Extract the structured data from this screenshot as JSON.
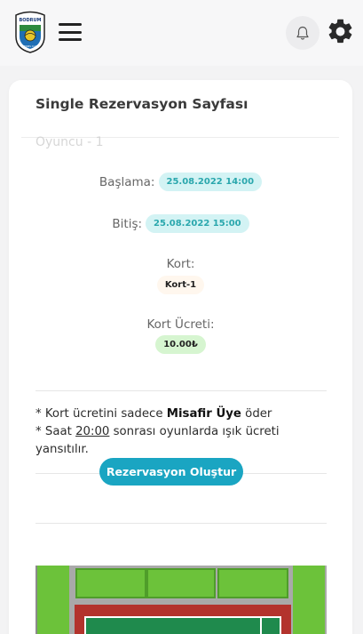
{
  "header": {
    "logo_text_top": "BODRUM",
    "logo_text_bottom": "TENNIS CLUB",
    "menu_icon": "hamburger-menu-icon",
    "notification_icon": "bell-icon",
    "settings_icon": "gear-icon"
  },
  "card": {
    "title": "Single Rezervasyon Sayfası"
  },
  "reservation": {
    "start_label": "Başlama:",
    "start_value": "25.08.2022 14:00",
    "end_label": "Bitiş:",
    "end_value": "25.08.2022 15:00",
    "court_label": "Kort:",
    "court_value": "Kort-1",
    "fee_label": "Kort Ücreti:",
    "fee_value": "10.00₺"
  },
  "notes": {
    "line1_prefix": "* Kort ücretini sadece ",
    "line1_bold": "Misafir Üye",
    "line1_suffix": " öder",
    "line2_prefix": "* Saat ",
    "line2_time": "20:00",
    "line2_suffix": " sonrası oyunlarda ışık ücreti yansıtılır."
  },
  "actions": {
    "create_label": "Rezervasyon Oluştur"
  },
  "court_map": {
    "player_label": "Oyuncu - 1"
  },
  "colors": {
    "accent": "#1aa5c2",
    "badge_cyan_bg": "#d3f3f4",
    "badge_cyan_text": "#2aa7ad",
    "badge_green_bg": "#d6f5d0",
    "court_red": "#b3332d",
    "court_green": "#1f8a4d",
    "hedge": "#6cc23a"
  }
}
